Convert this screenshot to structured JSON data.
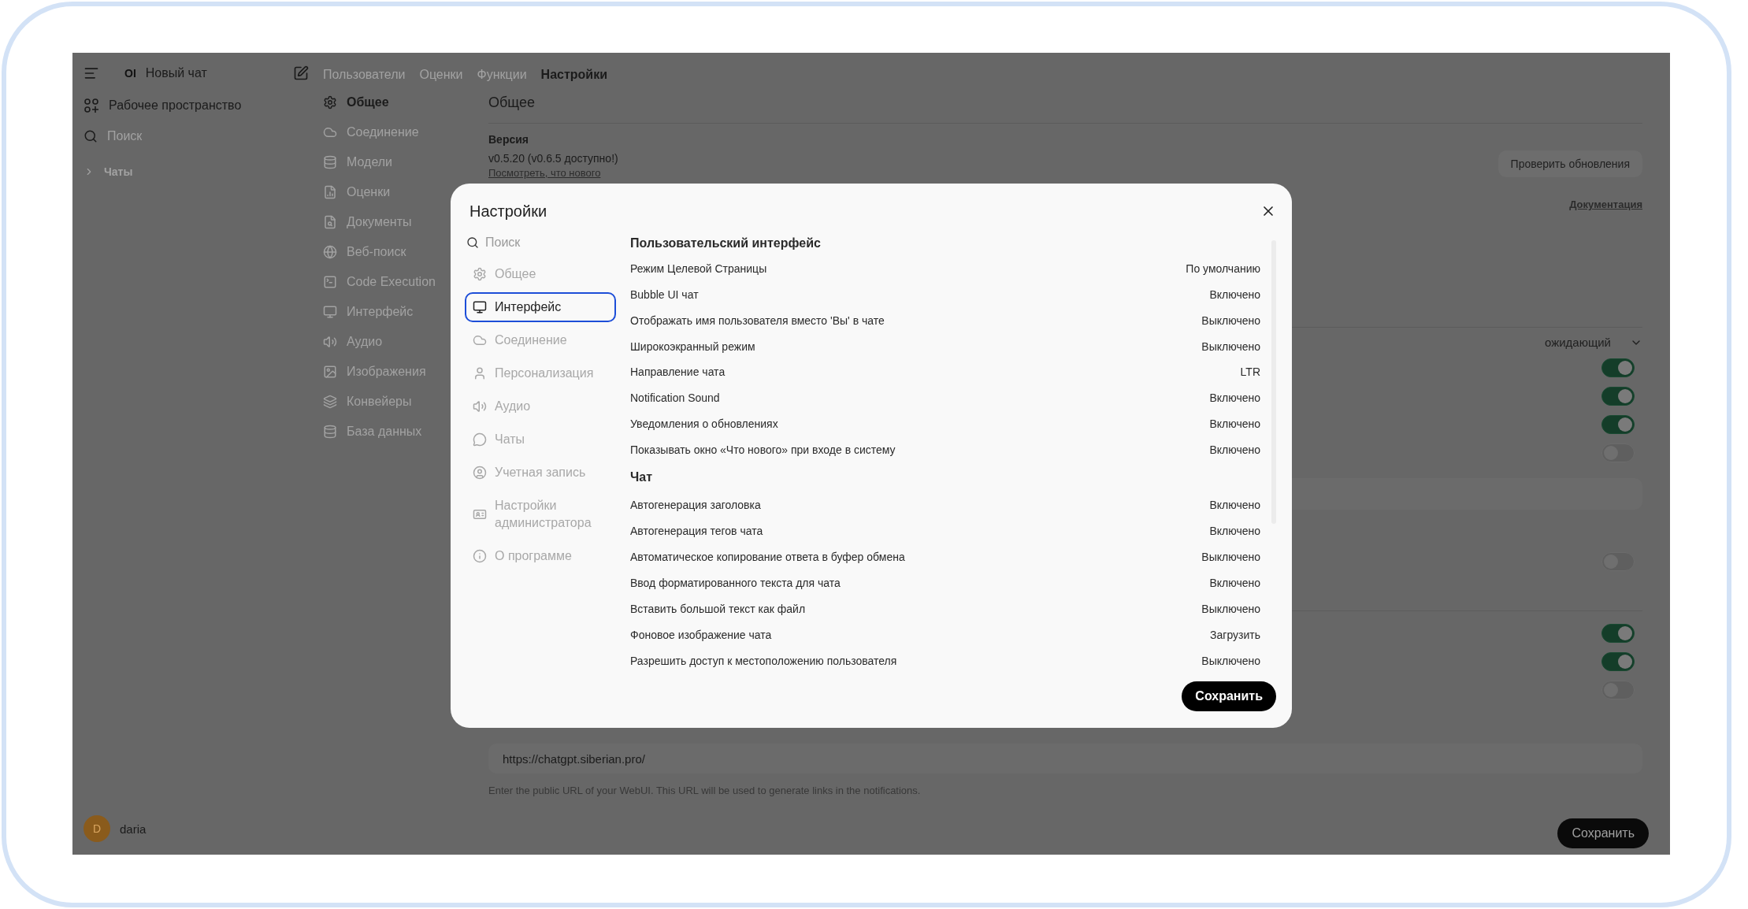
{
  "sidebar": {
    "logo": "OI",
    "title": "Новый чат",
    "workspace": "Рабочее пространство",
    "search_placeholder": "Поиск",
    "section": "Чаты",
    "user": {
      "initial": "D",
      "name": "daria"
    }
  },
  "admin_tabs": [
    {
      "label": "Пользователи",
      "selected": false
    },
    {
      "label": "Оценки",
      "selected": false
    },
    {
      "label": "Функции",
      "selected": false
    },
    {
      "label": "Настройки",
      "selected": true
    }
  ],
  "admin_nav": [
    {
      "label": "Общее",
      "selected": true
    },
    {
      "label": "Соединение",
      "selected": false
    },
    {
      "label": "Модели",
      "selected": false
    },
    {
      "label": "Оценки",
      "selected": false
    },
    {
      "label": "Документы",
      "selected": false
    },
    {
      "label": "Веб-поиск",
      "selected": false
    },
    {
      "label": "Code Execution",
      "selected": false
    },
    {
      "label": "Интерфейс",
      "selected": false
    },
    {
      "label": "Аудио",
      "selected": false
    },
    {
      "label": "Изображения",
      "selected": false
    },
    {
      "label": "Конвейеры",
      "selected": false
    },
    {
      "label": "База данных",
      "selected": false
    }
  ],
  "general": {
    "title": "Общее",
    "version_label": "Версия",
    "version": "v0.5.20 (v0.6.5 доступно!)",
    "whats_new": "Посмотреть, что нового",
    "check_updates": "Проверить обновления",
    "docs": "Документация",
    "dropdown": "ожидающий",
    "toggles_1": [
      {
        "on": true
      },
      {
        "on": true
      },
      {
        "on": true
      },
      {
        "on": false
      }
    ],
    "toggles_2": [
      {
        "on": false
      }
    ],
    "toggles_3": [
      {
        "on": true
      },
      {
        "on": true
      },
      {
        "on": false
      }
    ],
    "webui_url": "https://chatgpt.siberian.pro/",
    "webui_hint": "Enter the public URL of your WebUI. This URL will be used to generate links in the notifications.",
    "save": "Сохранить"
  },
  "modal": {
    "title": "Настройки",
    "search_placeholder": "Поиск",
    "nav": [
      {
        "label": "Общее",
        "selected": false
      },
      {
        "label": "Интерфейс",
        "selected": true
      },
      {
        "label": "Соединение",
        "selected": false
      },
      {
        "label": "Персонализация",
        "selected": false
      },
      {
        "label": "Аудио",
        "selected": false
      },
      {
        "label": "Чаты",
        "selected": false
      },
      {
        "label": "Учетная запись",
        "selected": false
      },
      {
        "label": "Настройки администратора",
        "selected": false
      },
      {
        "label": "О программе",
        "selected": false
      }
    ],
    "sections": [
      {
        "title": "Пользовательский интерфейс",
        "rows": [
          {
            "label": "Режим Целевой Страницы",
            "value": "По умолчанию"
          },
          {
            "label": "Bubble UI чат",
            "value": "Включено"
          },
          {
            "label": "Отображать имя пользователя вместо 'Вы' в чате",
            "value": "Выключено"
          },
          {
            "label": "Широкоэкранный режим",
            "value": "Выключено"
          },
          {
            "label": "Направление чата",
            "value": "LTR"
          },
          {
            "label": "Notification Sound",
            "value": "Включено"
          },
          {
            "label": "Уведомления о обновлениях",
            "value": "Включено"
          },
          {
            "label": "Показывать окно «Что нового» при входе в систему",
            "value": "Включено"
          }
        ]
      },
      {
        "title": "Чат",
        "rows": [
          {
            "label": "Автогенерация заголовка",
            "value": "Включено"
          },
          {
            "label": "Автогенерация тегов чата",
            "value": "Включено"
          },
          {
            "label": "Автоматическое копирование ответа в буфер обмена",
            "value": "Выключено"
          },
          {
            "label": "Ввод форматированного текста для чата",
            "value": "Включено"
          },
          {
            "label": "Вставить большой текст как файл",
            "value": "Выключено"
          },
          {
            "label": "Фоновое изображение чата",
            "value": "Загрузить"
          },
          {
            "label": "Разрешить доступ к местоположению пользователя",
            "value": "Выключено"
          }
        ]
      }
    ],
    "save": "Сохранить"
  }
}
